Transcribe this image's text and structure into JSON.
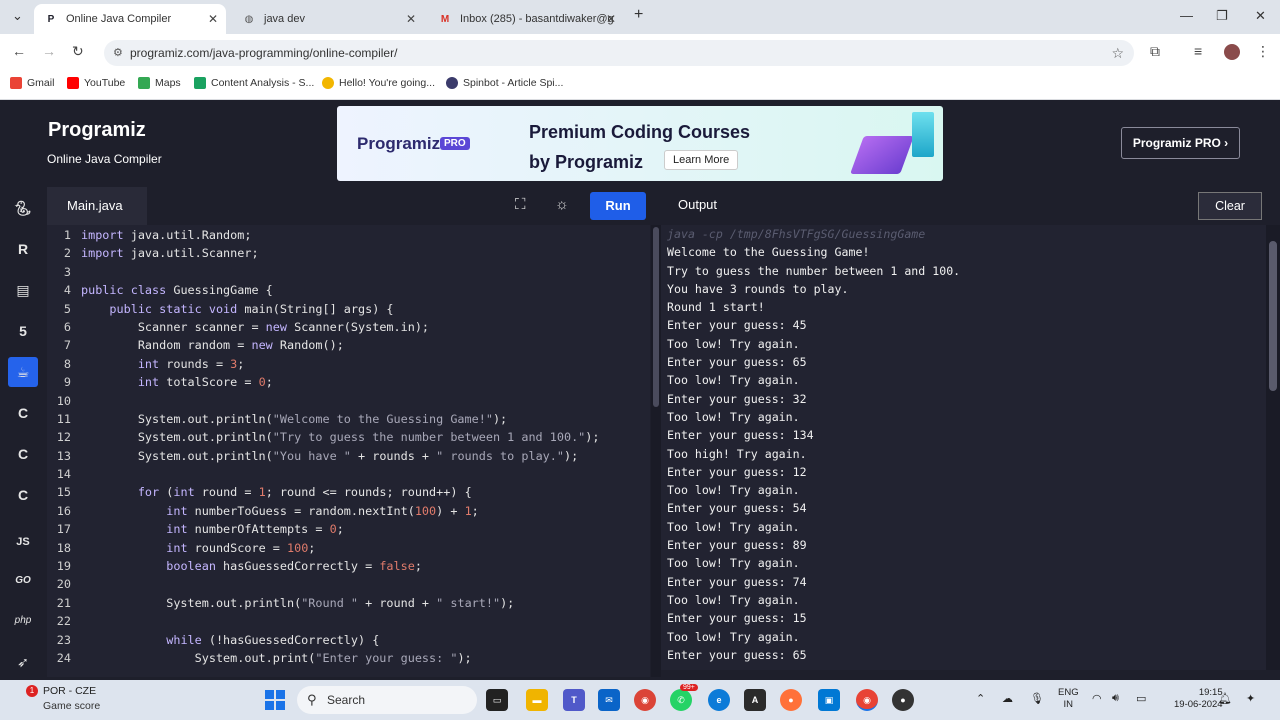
{
  "browser": {
    "tabs": [
      {
        "title": "Online Java Compiler",
        "active": true
      },
      {
        "title": "java dev",
        "active": false
      },
      {
        "title": "Inbox (285) - basantdiwaker@g",
        "active": false
      }
    ],
    "url": "programiz.com/java-programming/online-compiler/",
    "bookmarks": [
      "Gmail",
      "YouTube",
      "Maps",
      "Content Analysis - S...",
      "Hello! You're going...",
      "Spinbot - Article Spi..."
    ]
  },
  "header": {
    "logo": "Programiz",
    "subtitle": "Online Java Compiler",
    "banner": {
      "brand": "Programiz",
      "badge": "PRO",
      "line1": "Premium Coding Courses",
      "line2": "by Programiz",
      "cta": "Learn More"
    },
    "pro_button": "Programiz PRO ›"
  },
  "rail": [
    "python",
    "r",
    "sql",
    "html",
    "java",
    "c",
    "cpp",
    "csharp",
    "JS",
    "GO",
    "php",
    "swift"
  ],
  "editor": {
    "filename": "Main.java",
    "run_label": "Run",
    "lines": [
      [
        [
          "kw",
          "import"
        ],
        [
          "ct",
          " java.util.Random;"
        ]
      ],
      [
        [
          "kw",
          "import"
        ],
        [
          "ct",
          " java.util.Scanner;"
        ]
      ],
      [],
      [
        [
          "kw",
          "public class"
        ],
        [
          "ct",
          " GuessingGame {"
        ]
      ],
      [
        [
          "ct",
          "    "
        ],
        [
          "kw",
          "public static void"
        ],
        [
          "ct",
          " main(String[] args) {"
        ]
      ],
      [
        [
          "ct",
          "        Scanner scanner = "
        ],
        [
          "kw",
          "new"
        ],
        [
          "ct",
          " Scanner(System.in);"
        ]
      ],
      [
        [
          "ct",
          "        Random random = "
        ],
        [
          "kw",
          "new"
        ],
        [
          "ct",
          " Random();"
        ]
      ],
      [
        [
          "ct",
          "        "
        ],
        [
          "kw",
          "int"
        ],
        [
          "ct",
          " rounds = "
        ],
        [
          "num",
          "3"
        ],
        [
          "ct",
          ";"
        ]
      ],
      [
        [
          "ct",
          "        "
        ],
        [
          "kw",
          "int"
        ],
        [
          "ct",
          " totalScore = "
        ],
        [
          "num",
          "0"
        ],
        [
          "ct",
          ";"
        ]
      ],
      [],
      [
        [
          "ct",
          "        System.out.println("
        ],
        [
          "str",
          "\"Welcome to the Guessing Game!\""
        ],
        [
          "ct",
          ");"
        ]
      ],
      [
        [
          "ct",
          "        System.out.println("
        ],
        [
          "str",
          "\"Try to guess the number between 1 and 100.\""
        ],
        [
          "ct",
          ");"
        ]
      ],
      [
        [
          "ct",
          "        System.out.println("
        ],
        [
          "str",
          "\"You have \""
        ],
        [
          "ct",
          " + rounds + "
        ],
        [
          "str",
          "\" rounds to play.\""
        ],
        [
          "ct",
          ");"
        ]
      ],
      [],
      [
        [
          "ct",
          "        "
        ],
        [
          "kw",
          "for"
        ],
        [
          "ct",
          " ("
        ],
        [
          "kw",
          "int"
        ],
        [
          "ct",
          " round = "
        ],
        [
          "num",
          "1"
        ],
        [
          "ct",
          "; round <= rounds; round++) {"
        ]
      ],
      [
        [
          "ct",
          "            "
        ],
        [
          "kw",
          "int"
        ],
        [
          "ct",
          " numberToGuess = random.nextInt("
        ],
        [
          "num",
          "100"
        ],
        [
          "ct",
          ") + "
        ],
        [
          "num",
          "1"
        ],
        [
          "ct",
          ";"
        ]
      ],
      [
        [
          "ct",
          "            "
        ],
        [
          "kw",
          "int"
        ],
        [
          "ct",
          " numberOfAttempts = "
        ],
        [
          "num",
          "0"
        ],
        [
          "ct",
          ";"
        ]
      ],
      [
        [
          "ct",
          "            "
        ],
        [
          "kw",
          "int"
        ],
        [
          "ct",
          " roundScore = "
        ],
        [
          "num",
          "100"
        ],
        [
          "ct",
          ";"
        ]
      ],
      [
        [
          "ct",
          "            "
        ],
        [
          "kw",
          "boolean"
        ],
        [
          "ct",
          " hasGuessedCorrectly = "
        ],
        [
          "num",
          "false"
        ],
        [
          "ct",
          ";"
        ]
      ],
      [],
      [
        [
          "ct",
          "            System.out.println("
        ],
        [
          "str",
          "\"Round \""
        ],
        [
          "ct",
          " + round + "
        ],
        [
          "str",
          "\" start!\""
        ],
        [
          "ct",
          ");"
        ]
      ],
      [],
      [
        [
          "ct",
          "            "
        ],
        [
          "kw",
          "while"
        ],
        [
          "ct",
          " (!hasGuessedCorrectly) {"
        ]
      ],
      [
        [
          "ct",
          "                System.out.print("
        ],
        [
          "str",
          "\"Enter your guess: \""
        ],
        [
          "ct",
          ");"
        ]
      ]
    ]
  },
  "output": {
    "label": "Output",
    "clear_label": "Clear",
    "command": "java -cp /tmp/8FhsVTFgSG/GuessingGame",
    "lines": [
      "Welcome to the Guessing Game!",
      "Try to guess the number between 1 and 100.",
      "You have 3 rounds to play.",
      "Round 1 start!",
      "Enter your guess: 45",
      "Too low! Try again.",
      "Enter your guess: 65",
      "Too low! Try again.",
      "Enter your guess: 32",
      "Too low! Try again.",
      "Enter your guess: 134",
      "Too high! Try again.",
      "Enter your guess: 12",
      "Too low! Try again.",
      "Enter your guess: 54",
      "Too low! Try again.",
      "Enter your guess: 89",
      "Too low! Try again.",
      "Enter your guess: 74",
      "Too low! Try again.",
      "Enter your guess: 15",
      "Too low! Try again.",
      "Enter your guess: 65"
    ]
  },
  "taskbar": {
    "weather_title": "POR - CZE",
    "weather_sub": "Game score",
    "weather_badge": "1",
    "search_placeholder": "Search",
    "notif_badge": "99+",
    "lang_line1": "ENG",
    "lang_line2": "IN",
    "time": "19:15",
    "date": "19-06-2024"
  },
  "colors": {
    "accent": "#2563eb",
    "run": "#1f5ee8",
    "bg": "#1e1f2b",
    "editor_bg": "#222331"
  }
}
